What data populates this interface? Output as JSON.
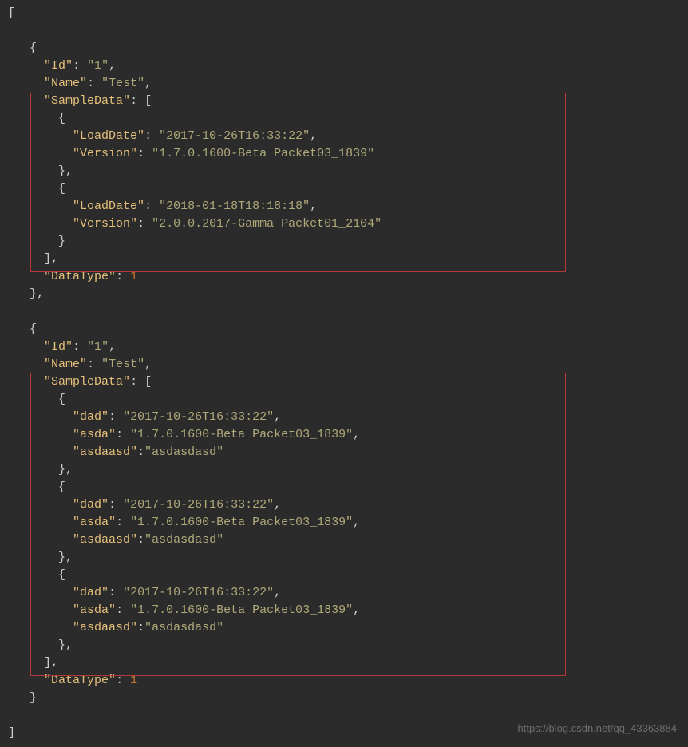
{
  "code": {
    "obj1": {
      "id_key": "Id",
      "id_val": "1",
      "name_key": "Name",
      "name_val": "Test",
      "sample_key": "SampleData",
      "item1": {
        "k1": "LoadDate",
        "v1": "2017-10-26T16:33:22",
        "k2": "Version",
        "v2": "1.7.0.1600-Beta Packet03_1839"
      },
      "item2": {
        "k1": "LoadDate",
        "v1": "2018-01-18T18:18:18",
        "k2": "Version",
        "v2": "2.0.0.2017-Gamma Packet01_2104"
      },
      "dt_key": "DataType",
      "dt_val": "1"
    },
    "obj2": {
      "id_key": "Id",
      "id_val": "1",
      "name_key": "Name",
      "name_val": "Test",
      "sample_key": "SampleData",
      "item1": {
        "k1": "dad",
        "v1": "2017-10-26T16:33:22",
        "k2": "asda",
        "v2": "1.7.0.1600-Beta Packet03_1839",
        "k3": "asdaasd",
        "v3": "asdasdasd"
      },
      "item2": {
        "k1": "dad",
        "v1": "2017-10-26T16:33:22",
        "k2": "asda",
        "v2": "1.7.0.1600-Beta Packet03_1839",
        "k3": "asdaasd",
        "v3": "asdasdasd"
      },
      "item3": {
        "k1": "dad",
        "v1": "2017-10-26T16:33:22",
        "k2": "asda",
        "v2": "1.7.0.1600-Beta Packet03_1839",
        "k3": "asdaasd",
        "v3": "asdasdasd"
      },
      "dt_key": "DataType",
      "dt_val": "1"
    }
  },
  "watermark": "https://blog.csdn.net/qq_43363884"
}
